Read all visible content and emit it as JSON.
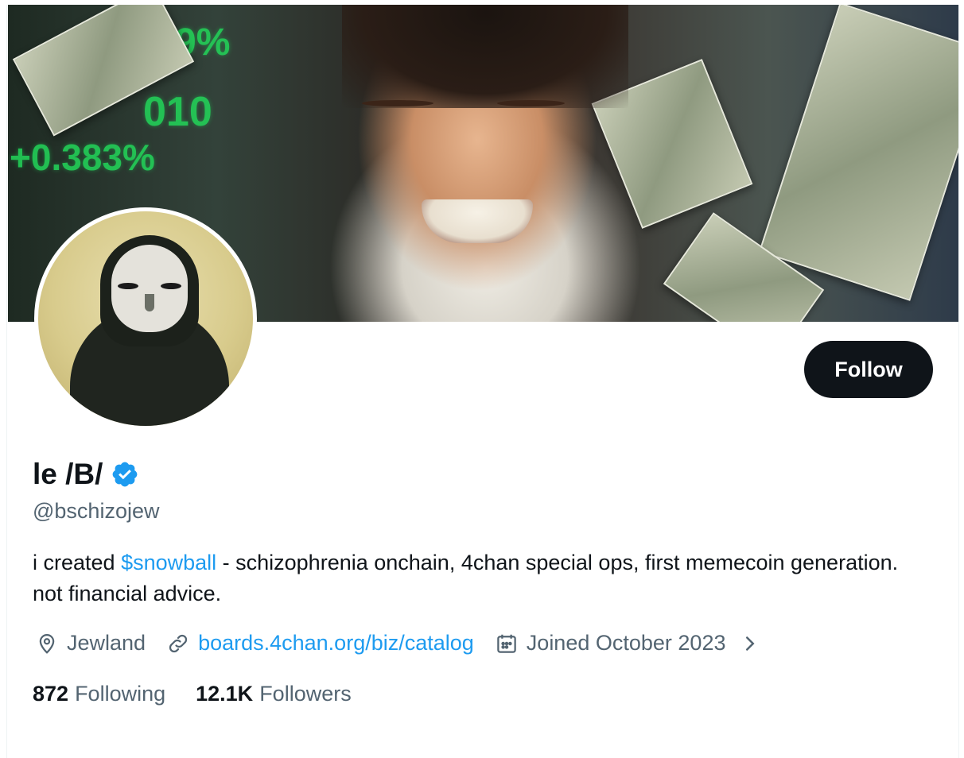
{
  "banner": {
    "tickers": [
      "+0.383%",
      "010",
      "9%"
    ]
  },
  "profile": {
    "display_name": "le /B/",
    "handle": "@bschizojew",
    "follow_label": "Follow",
    "bio": {
      "prefix": "i created ",
      "cashtag": "$snowball",
      "suffix": " - schizophrenia onchain, 4chan special ops, first memecoin generation. not financial advice."
    },
    "meta": {
      "location": "Jewland",
      "link": "boards.4chan.org/biz/catalog",
      "joined": "Joined October 2023"
    },
    "stats": {
      "following_count": "872",
      "following_label": "Following",
      "followers_count": "12.1K",
      "followers_label": "Followers"
    }
  },
  "colors": {
    "accent": "#1d9bf0",
    "text_primary": "#0f1419",
    "text_secondary": "#536471",
    "button_bg": "#0f1419"
  },
  "icons": {
    "verified": "verified-badge-icon",
    "location": "location-pin-icon",
    "link": "link-icon",
    "calendar": "calendar-icon",
    "chevron": "chevron-right-icon"
  }
}
